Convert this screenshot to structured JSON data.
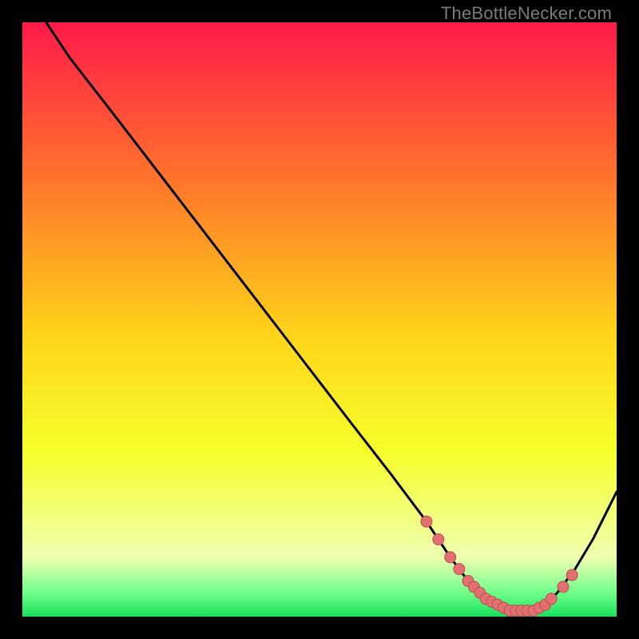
{
  "watermark": "TheBottleNecker.com",
  "colors": {
    "bg_black": "#000000",
    "grad_top": "#ff1a4a",
    "grad_mid_upper": "#ff7a2a",
    "grad_mid": "#ffd21a",
    "grad_mid_lower": "#f6ff2a",
    "grad_low": "#f0ffb0",
    "grad_green": "#18e05a",
    "curve": "#000000",
    "marker_fill": "#e37070",
    "marker_stroke": "#b85050"
  },
  "chart_data": {
    "type": "line",
    "title": "",
    "xlabel": "",
    "ylabel": "",
    "xlim": [
      0,
      100
    ],
    "ylim": [
      0,
      100
    ],
    "series": [
      {
        "name": "curve",
        "x": [
          0,
          4,
          8,
          15,
          25,
          35,
          45,
          55,
          62,
          68,
          72,
          75,
          78,
          80,
          82,
          84,
          86,
          88,
          90,
          93,
          96,
          100
        ],
        "y": [
          110,
          100,
          94,
          85,
          72,
          59,
          46,
          33,
          24,
          16,
          10,
          6,
          3,
          2,
          1,
          1,
          1,
          2,
          4,
          8,
          13,
          21
        ]
      }
    ],
    "markers": {
      "name": "highlight-dots",
      "x": [
        68,
        70,
        72,
        73.5,
        75,
        76,
        77,
        78,
        79,
        80,
        81,
        82,
        83,
        84,
        85,
        86,
        87,
        88,
        89,
        91,
        92.5
      ],
      "y": [
        16,
        13,
        10,
        8,
        6,
        5,
        4,
        3,
        2.5,
        2,
        1.5,
        1,
        1,
        1,
        1,
        1,
        1.5,
        2,
        3,
        5,
        7
      ]
    }
  }
}
